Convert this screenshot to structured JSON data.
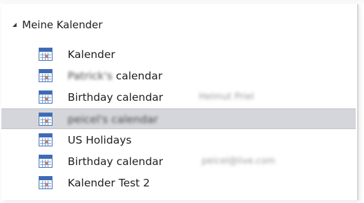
{
  "group": {
    "label": "Meine Kalender",
    "expanded": true
  },
  "icon": "calendar-icon",
  "calendars": [
    {
      "name": "Kalender",
      "prefix": "",
      "suffix": "",
      "owner": ""
    },
    {
      "name": "",
      "prefix": "Patrick's",
      "suffix": "calendar",
      "owner": ""
    },
    {
      "name": "Birthday calendar",
      "prefix": "",
      "suffix": "",
      "owner": "Helmut Priel"
    },
    {
      "name": "",
      "prefix": "peicel's calendar",
      "suffix": "",
      "owner": "",
      "selected": true
    },
    {
      "name": "US Holidays",
      "prefix": "",
      "suffix": "",
      "owner": ""
    },
    {
      "name": "Birthday calendar",
      "prefix": "",
      "suffix": "",
      "owner": "peicel@live.com"
    },
    {
      "name": "Kalender Test 2",
      "prefix": "",
      "suffix": "",
      "owner": ""
    }
  ],
  "colors": {
    "selection": "#d5d6db",
    "icon_blue": "#3d6bb5",
    "text": "#1e1e1e"
  }
}
